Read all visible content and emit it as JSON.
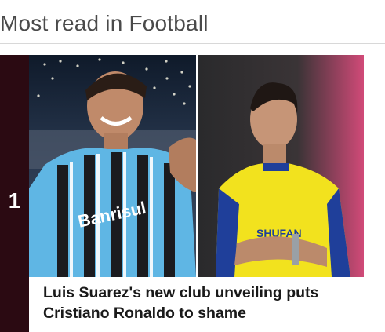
{
  "section": {
    "title": "Most read in Football"
  },
  "articles": [
    {
      "rank": "1",
      "headline": "Luis Suarez's new club unveiling puts Cristiano Ronaldo to shame",
      "image": {
        "left_shirt_text": "Banrisul",
        "right_shirt_text": "SHUFAN"
      }
    }
  ],
  "colors": {
    "rank_bar": "#2b0a12",
    "title_text": "#4a4a4a",
    "headline_text": "#1a1a1a"
  }
}
